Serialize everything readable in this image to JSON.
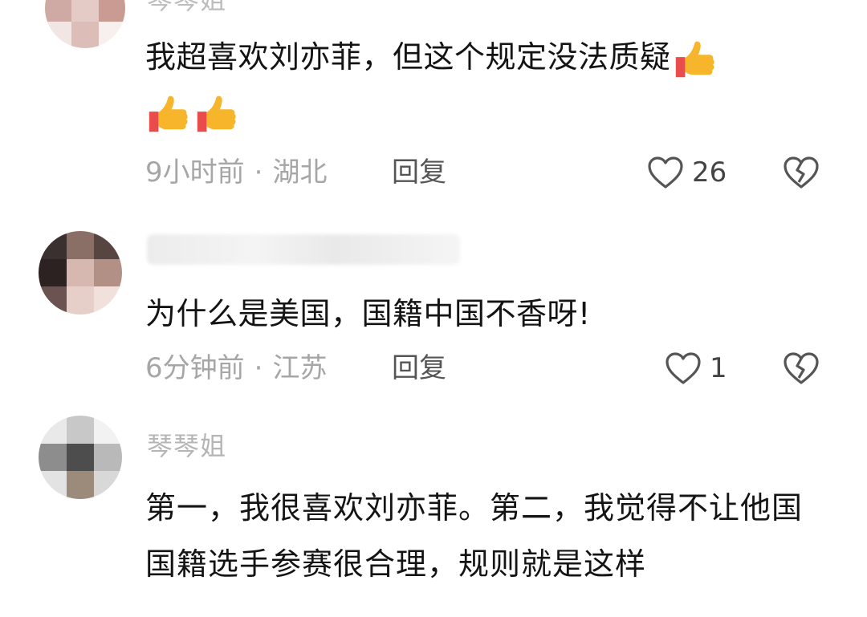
{
  "comments": [
    {
      "username": "琴琴姐",
      "text": "我超喜欢刘亦菲，但这个规定没法质疑",
      "emoji": [
        "thumbs-up-icon",
        "thumbs-up-icon",
        "thumbs-up-icon"
      ],
      "time": "9小时前",
      "location": "湖北",
      "reply_label": "回复",
      "likes": "26"
    },
    {
      "username": "",
      "text": "为什么是美国，国籍中国不香呀!",
      "time": "6分钟前",
      "location": "江苏",
      "reply_label": "回复",
      "likes": "1"
    },
    {
      "username": "琴琴姐",
      "text": "第一，我很喜欢刘亦菲。第二，我觉得不让他国国籍选手参赛很合理，规则就是这样"
    }
  ],
  "separator": "·",
  "colors": {
    "text": "#141414",
    "meta": "#a6a6a6",
    "icon": "#555555",
    "thumb_yellow": "#f7b52c",
    "thumb_red": "#ea4b4b"
  }
}
